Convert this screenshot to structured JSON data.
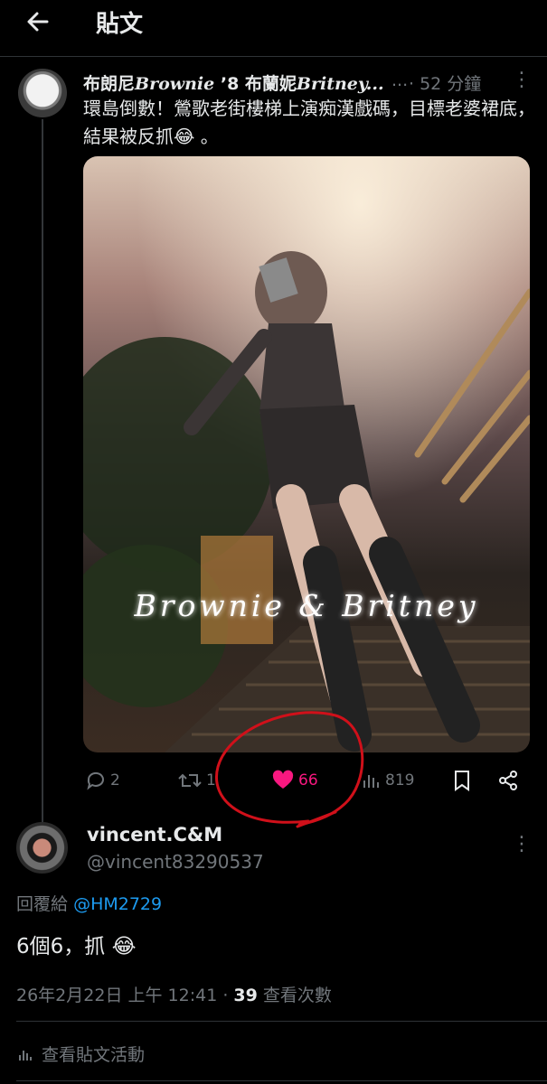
{
  "header": {
    "title": "貼文",
    "back_icon": "arrow-left-icon"
  },
  "tweet": {
    "author_name_prefix": "布朗尼",
    "author_name_latin1": "Brownie",
    "author_name_mid": " ␣♡ 布蘭妮",
    "author_name_latin2": "Britney...",
    "dots": "...",
    "time": "· 52 分鐘",
    "more": "⋮",
    "text": "環島倒數！鶯歌老街樓梯上演痴漢戲碼，目標老婆裙底，結果被反抓😂 。",
    "media_watermark": "Brownie & Britney",
    "actions": {
      "replies": "2",
      "retweets": "1",
      "likes": "66",
      "views": "819"
    }
  },
  "reply": {
    "name": "vincent.C&M",
    "handle": "@vincent83290537",
    "more": "⋮",
    "reply_to_label": "回覆給",
    "reply_to_handle": "@HM2729",
    "text": "6個6，抓 😂",
    "timestamp": "26年2月22日 上午 12:41 · ",
    "views_count": "39",
    "views_label": " 查看次數",
    "activity_label": "查看貼文活動"
  },
  "colors": {
    "like": "#f91880",
    "link": "#1d9bf0",
    "annotation": "#d0101a",
    "muted": "#71767b"
  }
}
